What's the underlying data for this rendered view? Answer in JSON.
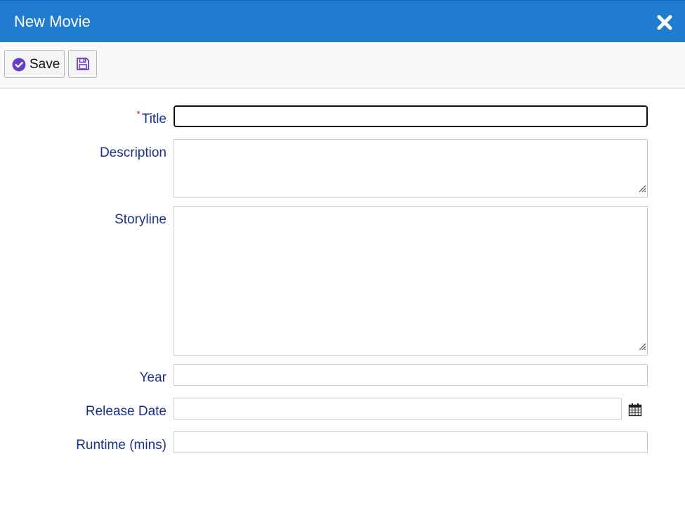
{
  "dialog": {
    "title": "New Movie"
  },
  "toolbar": {
    "save_label": "Save"
  },
  "form": {
    "required_marker": "*",
    "fields": {
      "title": {
        "label": "Title",
        "value": ""
      },
      "description": {
        "label": "Description",
        "value": ""
      },
      "storyline": {
        "label": "Storyline",
        "value": ""
      },
      "year": {
        "label": "Year",
        "value": ""
      },
      "release_date": {
        "label": "Release Date",
        "value": ""
      },
      "runtime": {
        "label": "Runtime (mins)",
        "value": ""
      }
    }
  },
  "icons": {
    "close": "close-icon",
    "save_check": "check-circle-icon",
    "save_disk": "floppy-disk-icon",
    "calendar": "calendar-icon",
    "resize": "resize-grip-icon"
  },
  "colors": {
    "titlebar": "#1f7ccf",
    "label": "#1c2f8a",
    "accent_icon": "#6b3fc2",
    "required": "#e02020"
  }
}
